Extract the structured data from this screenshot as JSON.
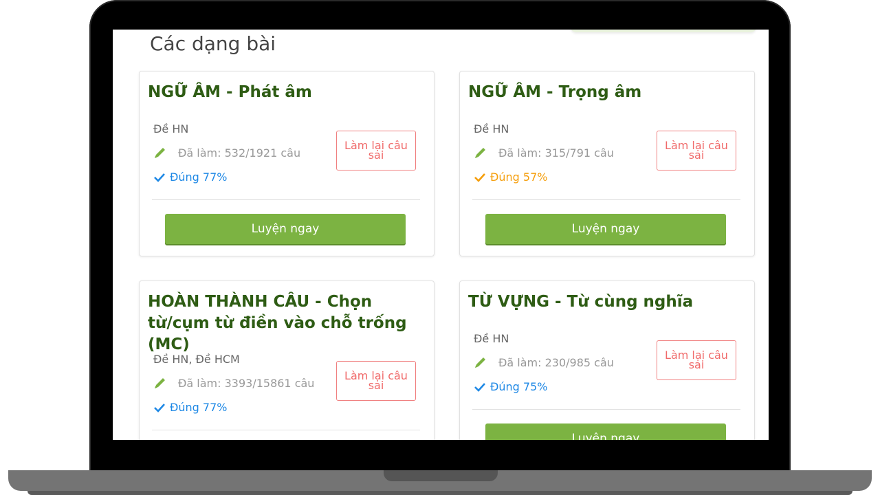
{
  "section_title": "Các dạng bài",
  "colors": {
    "title_green": "#2e5c14",
    "button_green": "#7cb342",
    "pencil_green": "#7cb342",
    "correct_blue": "#1e88e5",
    "correct_orange": "#f59e0b",
    "redo_red": "#f06a6a"
  },
  "cards": [
    {
      "title": "NGỮ ÂM - Phát âm",
      "tags": "Đề HN",
      "progress": "Đã làm: 532/1921 câu",
      "correct": "Đúng 77%",
      "redo_label": "Làm lại câu sai",
      "practice_label": "Luyện ngay"
    },
    {
      "title": "NGỮ ÂM - Trọng âm",
      "tags": "Đề HN",
      "progress": "Đã làm: 315/791 câu",
      "correct": "Đúng 57%",
      "redo_label": "Làm lại câu sai",
      "practice_label": "Luyện ngay"
    },
    {
      "title": "HOÀN THÀNH CÂU - Chọn từ/cụm từ điền vào chỗ trống (MC)",
      "tags": "Đề HN, Đề HCM",
      "progress": "Đã làm: 3393/15861 câu",
      "correct": "Đúng 77%",
      "redo_label": "Làm lại câu sai"
    },
    {
      "title": "TỪ VỰNG - Từ cùng nghĩa",
      "tags": "Đề HN",
      "progress": "Đã làm: 230/985 câu",
      "correct": "Đúng 75%",
      "redo_label": "Làm lại câu sai",
      "practice_label": "Luyện ngay"
    }
  ]
}
